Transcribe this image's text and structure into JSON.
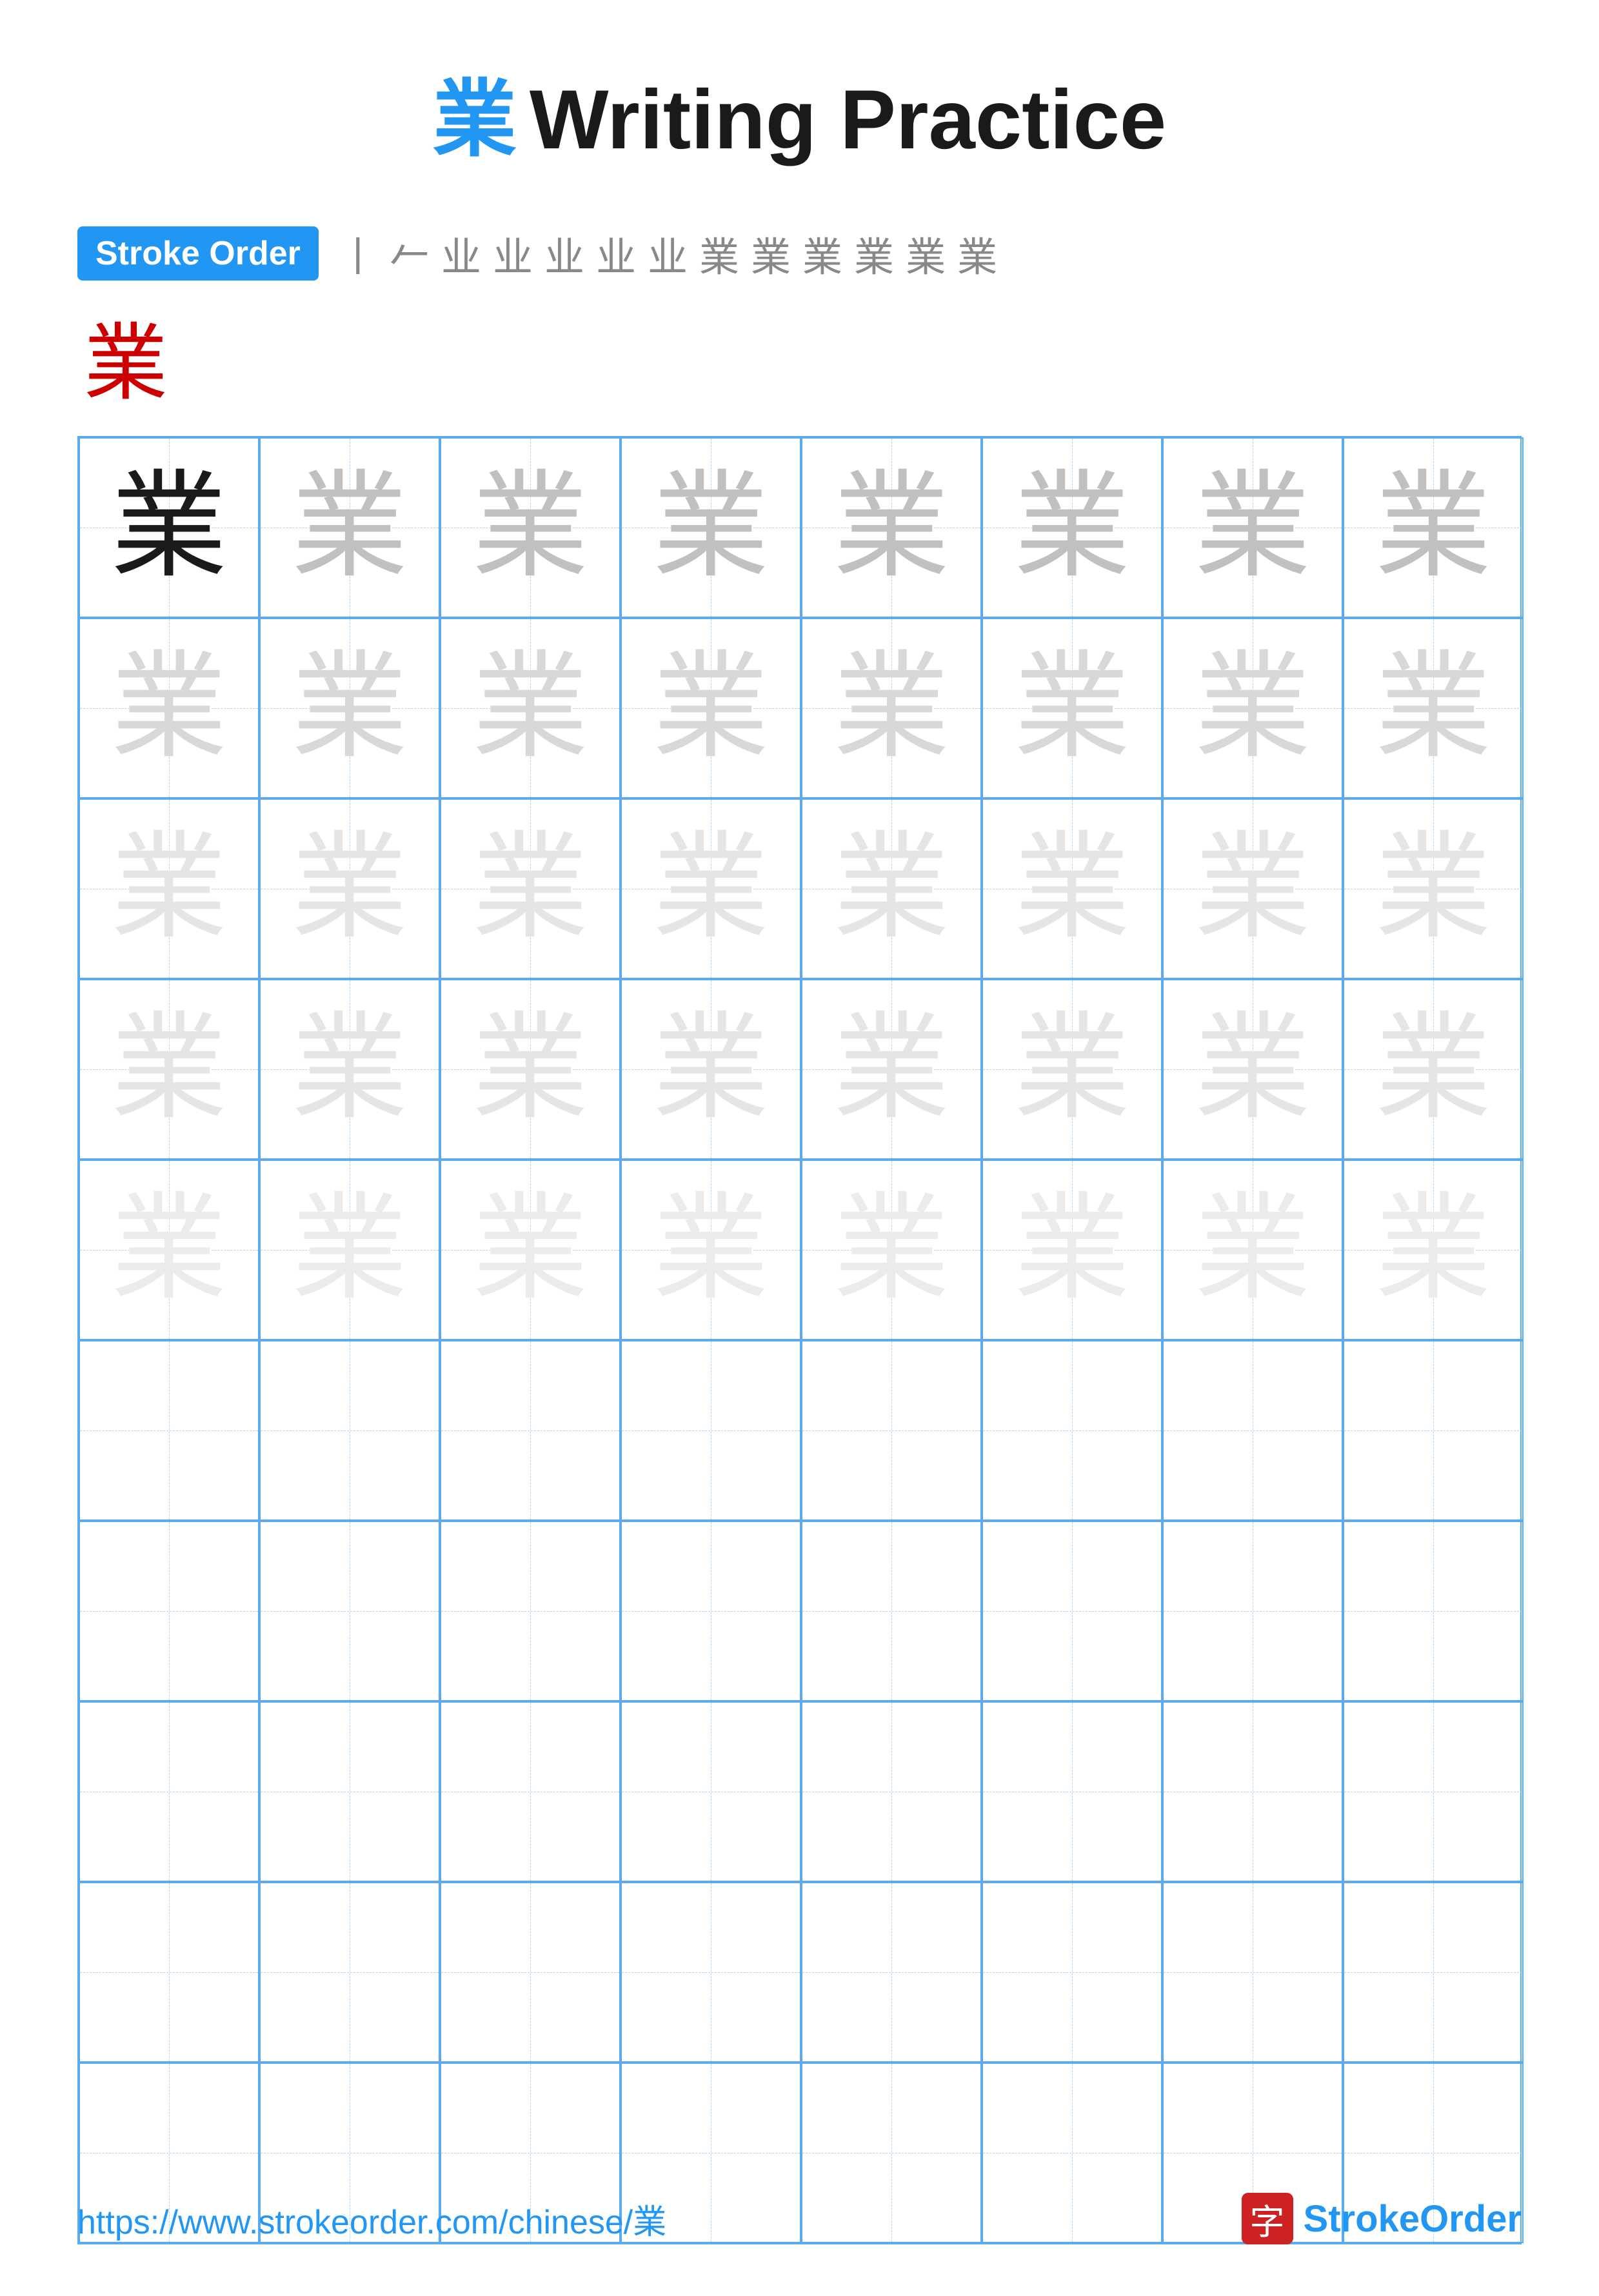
{
  "title": {
    "char": "業",
    "text": "Writing Practice"
  },
  "stroke_order": {
    "badge_label": "Stroke Order",
    "sequence": [
      "丨",
      "丷",
      "业",
      "业",
      "业",
      "业",
      "业",
      "业",
      "業",
      "業",
      "業",
      "業",
      "業"
    ],
    "display_char": "業"
  },
  "grid": {
    "cols": 8,
    "rows": 10,
    "char": "業",
    "filled_rows": 5,
    "shades": [
      "dark",
      "medium",
      "light",
      "very-light",
      "faint"
    ]
  },
  "footer": {
    "url": "https://www.strokeorder.com/chinese/業",
    "logo_char": "字",
    "logo_text_stroke": "Stroke",
    "logo_text_order": "Order"
  }
}
